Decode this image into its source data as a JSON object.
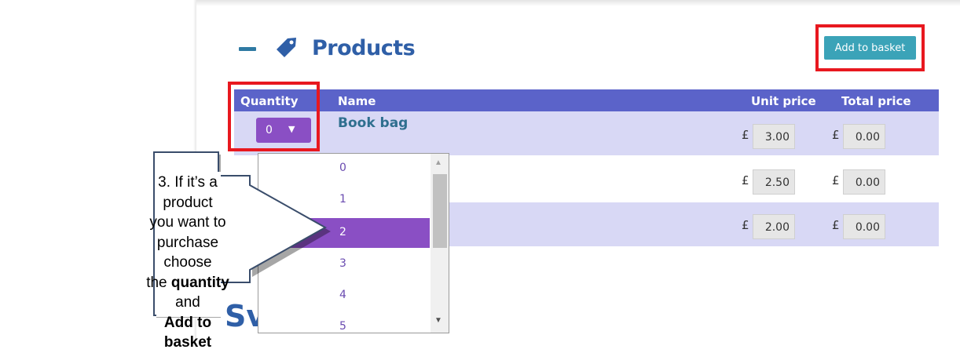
{
  "section": {
    "title": "Products",
    "collapse_icon": "minus-icon",
    "tag_icon": "tag-icon"
  },
  "actions": {
    "add_to_basket": "Add to basket"
  },
  "table": {
    "headers": {
      "quantity": "Quantity",
      "name": "Name",
      "unit_price": "Unit price",
      "total_price": "Total price"
    },
    "currency": "£",
    "rows": [
      {
        "quantity": "0",
        "name": "Book bag",
        "unit_price": "3.00",
        "total_price": "0.00"
      },
      {
        "unit_price": "2.50",
        "total_price": "0.00"
      },
      {
        "unit_price": "2.00",
        "total_price": "0.00"
      }
    ]
  },
  "dropdown": {
    "options": [
      "0",
      "1",
      "2",
      "3",
      "4",
      "5"
    ],
    "highlighted": "2"
  },
  "next_section_partial": "Sv",
  "callout": {
    "line1": "3. If it’s a product",
    "line2": "you want to",
    "line3": "purchase choose",
    "line4_prefix": "the ",
    "line4_bold": "quantity",
    "line4_suffix": " and",
    "line5_bold": "Add to basket"
  },
  "colors": {
    "header_bg": "#5b63c9",
    "row_alt_bg": "#d8d8f5",
    "select_bg": "#8a4fc4",
    "button_bg": "#3ba3b8",
    "highlight_border": "#e8181f",
    "title_color": "#2f5fa7"
  }
}
